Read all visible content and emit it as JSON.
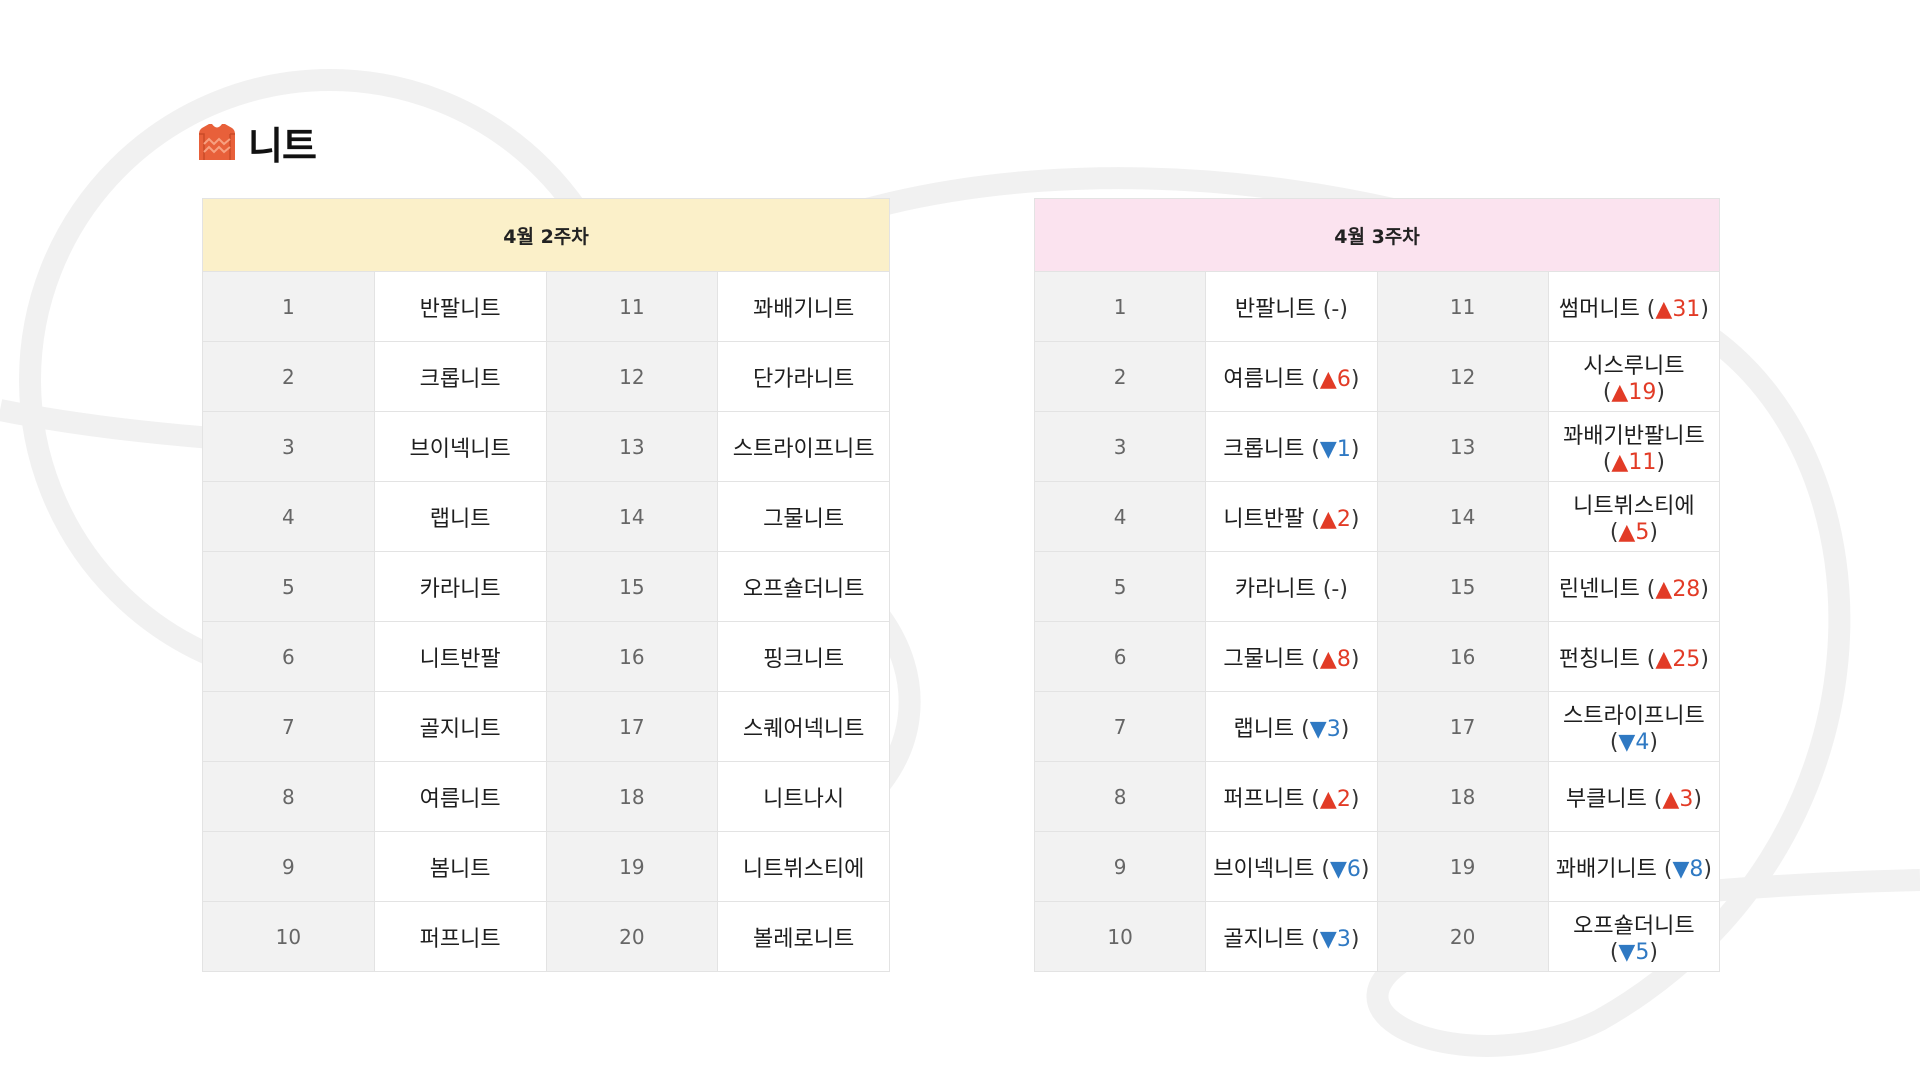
{
  "page": {
    "title": "니트",
    "icon": "sweater-icon",
    "accent_color": "#e8603a"
  },
  "colors": {
    "week1_header_bg": "#fbf0c9",
    "week2_header_bg": "#fbe3ef",
    "up": "#e23b26",
    "down": "#2f79c3"
  },
  "week1": {
    "header": "4월 2주차",
    "rows": [
      {
        "l_rank": "1",
        "l_item": "반팔니트",
        "r_rank": "11",
        "r_item": "꽈배기니트"
      },
      {
        "l_rank": "2",
        "l_item": "크롭니트",
        "r_rank": "12",
        "r_item": "단가라니트"
      },
      {
        "l_rank": "3",
        "l_item": "브이넥니트",
        "r_rank": "13",
        "r_item": "스트라이프니트"
      },
      {
        "l_rank": "4",
        "l_item": "랩니트",
        "r_rank": "14",
        "r_item": "그물니트"
      },
      {
        "l_rank": "5",
        "l_item": "카라니트",
        "r_rank": "15",
        "r_item": "오프숄더니트"
      },
      {
        "l_rank": "6",
        "l_item": "니트반팔",
        "r_rank": "16",
        "r_item": "핑크니트"
      },
      {
        "l_rank": "7",
        "l_item": "골지니트",
        "r_rank": "17",
        "r_item": "스퀘어넥니트"
      },
      {
        "l_rank": "8",
        "l_item": "여름니트",
        "r_rank": "18",
        "r_item": "니트나시"
      },
      {
        "l_rank": "9",
        "l_item": "봄니트",
        "r_rank": "19",
        "r_item": "니트뷔스티에"
      },
      {
        "l_rank": "10",
        "l_item": "퍼프니트",
        "r_rank": "20",
        "r_item": "볼레로니트"
      }
    ]
  },
  "week2": {
    "header": "4월 3주차",
    "rows": [
      {
        "l_rank": "1",
        "l_item": "반팔니트",
        "l_dir": "none",
        "l_chg": "-",
        "r_rank": "11",
        "r_item": "썸머니트",
        "r_dir": "up",
        "r_chg": "31"
      },
      {
        "l_rank": "2",
        "l_item": "여름니트",
        "l_dir": "up",
        "l_chg": "6",
        "r_rank": "12",
        "r_item": "시스루니트",
        "r_dir": "up",
        "r_chg": "19"
      },
      {
        "l_rank": "3",
        "l_item": "크롭니트",
        "l_dir": "down",
        "l_chg": "1",
        "r_rank": "13",
        "r_item": "꽈배기반팔니트",
        "r_dir": "up",
        "r_chg": "11"
      },
      {
        "l_rank": "4",
        "l_item": "니트반팔",
        "l_dir": "up",
        "l_chg": "2",
        "r_rank": "14",
        "r_item": "니트뷔스티에",
        "r_dir": "up",
        "r_chg": "5"
      },
      {
        "l_rank": "5",
        "l_item": "카라니트",
        "l_dir": "none",
        "l_chg": "-",
        "r_rank": "15",
        "r_item": "린넨니트",
        "r_dir": "up",
        "r_chg": "28"
      },
      {
        "l_rank": "6",
        "l_item": "그물니트",
        "l_dir": "up",
        "l_chg": "8",
        "r_rank": "16",
        "r_item": "펀칭니트",
        "r_dir": "up",
        "r_chg": "25"
      },
      {
        "l_rank": "7",
        "l_item": "랩니트",
        "l_dir": "down",
        "l_chg": "3",
        "r_rank": "17",
        "r_item": "스트라이프니트",
        "r_dir": "down",
        "r_chg": "4"
      },
      {
        "l_rank": "8",
        "l_item": "퍼프니트",
        "l_dir": "up",
        "l_chg": "2",
        "r_rank": "18",
        "r_item": "부클니트",
        "r_dir": "up",
        "r_chg": "3"
      },
      {
        "l_rank": "9",
        "l_item": "브이넥니트",
        "l_dir": "down",
        "l_chg": "6",
        "r_rank": "19",
        "r_item": "꽈배기니트",
        "r_dir": "down",
        "r_chg": "8"
      },
      {
        "l_rank": "10",
        "l_item": "골지니트",
        "l_dir": "down",
        "l_chg": "3",
        "r_rank": "20",
        "r_item": "오프숄더니트",
        "r_dir": "down",
        "r_chg": "5"
      }
    ]
  }
}
